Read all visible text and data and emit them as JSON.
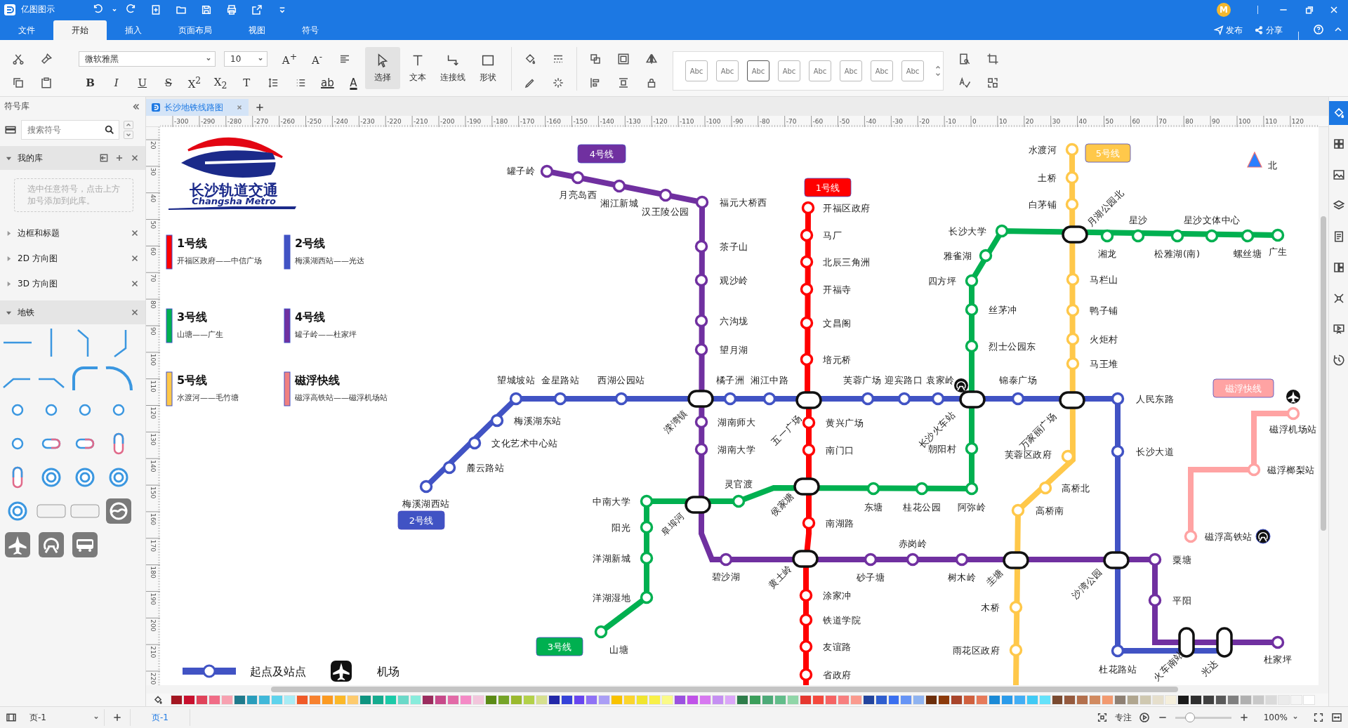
{
  "app": {
    "title": "亿图图示",
    "avatar": "M"
  },
  "menu_bar": {
    "tabs": [
      {
        "label": "文件",
        "selected": false
      },
      {
        "label": "开始",
        "selected": true
      },
      {
        "label": "插入",
        "selected": false
      },
      {
        "label": "页面布局",
        "selected": false
      },
      {
        "label": "视图",
        "selected": false
      },
      {
        "label": "符号",
        "selected": false
      }
    ],
    "actions": [
      "发布",
      "分享"
    ]
  },
  "ribbon": {
    "font_family": "微软雅黑",
    "font_size": "10",
    "size_buttons": [
      "A$^{+}$",
      "A$^{-}$"
    ],
    "format_buttons": [
      "B",
      "I",
      "U",
      "S",
      "X$^{2}$",
      "X$_{2}$",
      "T"
    ],
    "highlight": "ab",
    "font_color": "A",
    "tools": [
      {
        "label": "选择",
        "selected": true
      },
      {
        "label": "文本",
        "selected": false
      },
      {
        "label": "连接线",
        "selected": false
      },
      {
        "label": "形状",
        "selected": false
      }
    ],
    "styles": [
      "Abc",
      "Abc",
      "Abc",
      "Abc",
      "Abc",
      "Abc",
      "Abc",
      "Abc"
    ]
  },
  "library": {
    "title": "符号库",
    "search_placeholder": "搜索符号",
    "sections": [
      {
        "label": "我的库",
        "expanded": true,
        "hint": "选中任意符号，点击上方加号添加到此库。"
      },
      {
        "label": "边框和标题",
        "expanded": false
      },
      {
        "label": "2D 方向图",
        "expanded": false
      },
      {
        "label": "3D 方向图",
        "expanded": false
      },
      {
        "label": "地铁",
        "expanded": true
      }
    ]
  },
  "document_tab": {
    "label": "长沙地铁线路图"
  },
  "ruler": {
    "horizontal": [
      "-300",
      "-290",
      "-280",
      "-270",
      "-260",
      "-250",
      "-240",
      "-230",
      "-220",
      "-210",
      "-200",
      "-190",
      "-180",
      "-170",
      "-160",
      "-150",
      "-140",
      "-130",
      "-120",
      "-110",
      "-100",
      "-90",
      "-80",
      "-70",
      "-60",
      "-50",
      "-40",
      "-30",
      "-20",
      "-10",
      "0",
      "10",
      "20",
      "30",
      "40",
      "50",
      "60",
      "70",
      "80",
      "90",
      "100",
      "110",
      "120"
    ],
    "vertical": [
      "20",
      "30",
      "40",
      "50",
      "60",
      "70",
      "80",
      "90",
      "100",
      "110",
      "120",
      "130",
      "140",
      "150",
      "160",
      "170",
      "180",
      "190",
      "200",
      "210",
      "220"
    ]
  },
  "map": {
    "logo": {
      "name": "长沙轨道交通",
      "subtitle": "Changsha Metro"
    },
    "legend": [
      {
        "title": "1号线",
        "route": "开福区政府——中信广场",
        "color": "#ff0000"
      },
      {
        "title": "2号线",
        "route": "梅溪湖西站——光达",
        "color": "#4153c4"
      },
      {
        "title": "3号线",
        "route": "山塘——广生",
        "color": "#00b050"
      },
      {
        "title": "4号线",
        "route": "罐子岭——杜家坪",
        "color": "#7030a0"
      },
      {
        "title": "5号线",
        "route": "水渡河——毛竹塘",
        "color": "#ffc84a"
      },
      {
        "title": "磁浮快线",
        "route": "磁浮高铁站——磁浮机场站",
        "color": "#f08080"
      }
    ],
    "lines": [
      {
        "badge": "1号线",
        "color": "#ff0000",
        "stations": [
          "开福区政府",
          "马厂",
          "北辰三角洲",
          "开福寺",
          "文昌阁",
          "培元桥",
          "黄兴广场",
          "南门口",
          "南湖路",
          "涂家冲",
          "铁道学院",
          "友谊路",
          "省政府"
        ]
      },
      {
        "badge": "2号线",
        "color": "#4153c4",
        "stations": [
          "望城坡站",
          "金星路站",
          "西湖公园站",
          "橘子洲",
          "湘江中路",
          "芙蓉广场",
          "迎宾路口",
          "袁家岭",
          "锦泰广场",
          "人民东路",
          "梅溪湖东站",
          "文化艺术中心站",
          "长沙大道",
          "麓云路站",
          "梅溪湖西站",
          "杜花路站"
        ]
      },
      {
        "badge": "3号线",
        "color": "#00b050",
        "stations": [
          "长沙大学",
          "雅雀湖",
          "四方坪",
          "丝茅冲",
          "烈士公园东",
          "朝阳村",
          "中南大学",
          "阳光",
          "洋湖新城",
          "洋湖湿地",
          "山塘",
          "灵官渡",
          "东塘",
          "桂花公园",
          "阿弥岭",
          "湘龙",
          "星沙",
          "松雅湖(南)",
          "星沙文体中心",
          "螺丝塘",
          "广生"
        ]
      },
      {
        "badge": "4号线",
        "color": "#7030a0",
        "stations": [
          "罐子岭",
          "月亮岛西",
          "湘江新城",
          "汉王陵公园",
          "福元大桥西",
          "茶子山",
          "观沙岭",
          "六沟垅",
          "望月湖",
          "湖南师大",
          "湖南大学",
          "碧沙湖",
          "砂子塘",
          "赤岗岭",
          "树木岭",
          "粟塘",
          "平阳",
          "杜家坪"
        ]
      },
      {
        "badge": "5号线",
        "color": "#ffc84a",
        "stations": [
          "水渡河",
          "土桥",
          "白茅铺",
          "马栏山",
          "鸭子铺",
          "火炬村",
          "马王堆",
          "芙蓉区政府",
          "高桥北",
          "高桥南",
          "木桥",
          "雨花区政府"
        ]
      },
      {
        "badge": "磁浮快线",
        "color": "#ffa3a3",
        "stations": [
          "磁浮机场站",
          "磁浮榔梨站",
          "磁浮高铁站"
        ]
      }
    ],
    "interchanges": [
      "溁湾镇",
      "五一广场",
      "长沙火车站",
      "万家丽广场",
      "月湖公园北",
      "阜埠河",
      "侯家塘",
      "黄土岭",
      "圭塘",
      "沙湾公园",
      "火车南站",
      "光达"
    ],
    "north": "北",
    "key": [
      {
        "kind": "station",
        "label": "起点及站点"
      },
      {
        "kind": "airport",
        "label": "机场"
      }
    ]
  },
  "palette": [
    {
      "color": "#a31621"
    },
    {
      "color": "#c8102e"
    },
    {
      "color": "#e0435a"
    },
    {
      "color": "#f06c86"
    },
    {
      "color": "#f7a1b0"
    },
    {
      "color": "#1f7a8c"
    },
    {
      "color": "#2a9dbb"
    },
    {
      "color": "#40b8d9"
    },
    {
      "color": "#5ed3ec"
    },
    {
      "color": "#a8ecf5"
    },
    {
      "color": "#f05a28"
    },
    {
      "color": "#f7812f"
    },
    {
      "color": "#fb9a22"
    },
    {
      "color": "#fbb829"
    },
    {
      "color": "#fdcb6e"
    },
    {
      "color": "#0e9480"
    },
    {
      "color": "#16ab8f"
    },
    {
      "color": "#1ccaa8"
    },
    {
      "color": "#6ad9c8"
    },
    {
      "color": "#88ecdc"
    },
    {
      "color": "#9b2c5e"
    },
    {
      "color": "#c74a8a"
    },
    {
      "color": "#e26aa7"
    },
    {
      "color": "#f48ac6"
    },
    {
      "color": "#f2c6dc"
    },
    {
      "color": "#5a8a15"
    },
    {
      "color": "#75a428"
    },
    {
      "color": "#9ab92e"
    },
    {
      "color": "#b3d14a"
    },
    {
      "color": "#d6e08f"
    },
    {
      "color": "#2227a8"
    },
    {
      "color": "#3542d9"
    },
    {
      "color": "#6745f0"
    },
    {
      "color": "#8f72f5"
    },
    {
      "color": "#aa9ef5"
    },
    {
      "color": "#f8c200"
    },
    {
      "color": "#fbd52e"
    },
    {
      "color": "#f0e52e"
    },
    {
      "color": "#f8f048"
    },
    {
      "color": "#fafa88"
    },
    {
      "color": "#9b51e0"
    },
    {
      "color": "#c052e8"
    },
    {
      "color": "#d778f0"
    },
    {
      "color": "#c58ff2"
    },
    {
      "color": "#dba6f8"
    },
    {
      "color": "#2e7d4a"
    },
    {
      "color": "#3b9e5a"
    },
    {
      "color": "#4daa78"
    },
    {
      "color": "#62bd8a"
    },
    {
      "color": "#90d6a8"
    },
    {
      "color": "#e5372f"
    },
    {
      "color": "#f4493d"
    },
    {
      "color": "#f56464"
    },
    {
      "color": "#f77f7f"
    },
    {
      "color": "#fa9a8e"
    },
    {
      "color": "#22449e"
    },
    {
      "color": "#2f5ecf"
    },
    {
      "color": "#3a6ff0"
    },
    {
      "color": "#6694f5"
    },
    {
      "color": "#8fb3f0"
    },
    {
      "color": "#6b2d0a"
    },
    {
      "color": "#8c3a0a"
    },
    {
      "color": "#a8442a"
    },
    {
      "color": "#d0603e"
    },
    {
      "color": "#e67a5a"
    },
    {
      "color": "#1a8ad6"
    },
    {
      "color": "#2a9bea"
    },
    {
      "color": "#42aef5"
    },
    {
      "color": "#3fcaf5"
    },
    {
      "color": "#64e2fa"
    },
    {
      "color": "#7a4a30"
    },
    {
      "color": "#955a3e"
    },
    {
      "color": "#b3704d"
    },
    {
      "color": "#d18a60"
    },
    {
      "color": "#f29a70"
    },
    {
      "color": "#8e8073"
    },
    {
      "color": "#b0a68f"
    },
    {
      "color": "#cfc8b0"
    },
    {
      "color": "#e6dfcc"
    },
    {
      "color": "#f5efdc"
    },
    {
      "color": "#1a1a1a"
    },
    {
      "color": "#2e2e2e"
    },
    {
      "color": "#404040"
    },
    {
      "color": "#5a5a5a"
    },
    {
      "color": "#808080"
    },
    {
      "color": "#b0b0b0"
    },
    {
      "color": "#c8c8c8"
    },
    {
      "color": "#dadada"
    },
    {
      "color": "#ebebeb"
    },
    {
      "color": "#f5f5f5"
    },
    {
      "color": "#ffffff"
    }
  ],
  "side_panel": [
    {
      "selected": true
    },
    {
      "selected": false
    },
    {
      "selected": false
    },
    {
      "selected": false
    },
    {
      "selected": false
    },
    {
      "selected": false
    },
    {
      "selected": false
    },
    {
      "selected": false
    },
    {
      "selected": false
    }
  ],
  "status_bar": {
    "page_select": "页-1",
    "page_tab": "页-1",
    "focus": "专注",
    "zoom": "100%",
    "zoom_slider": {
      "level": 0.25
    }
  }
}
